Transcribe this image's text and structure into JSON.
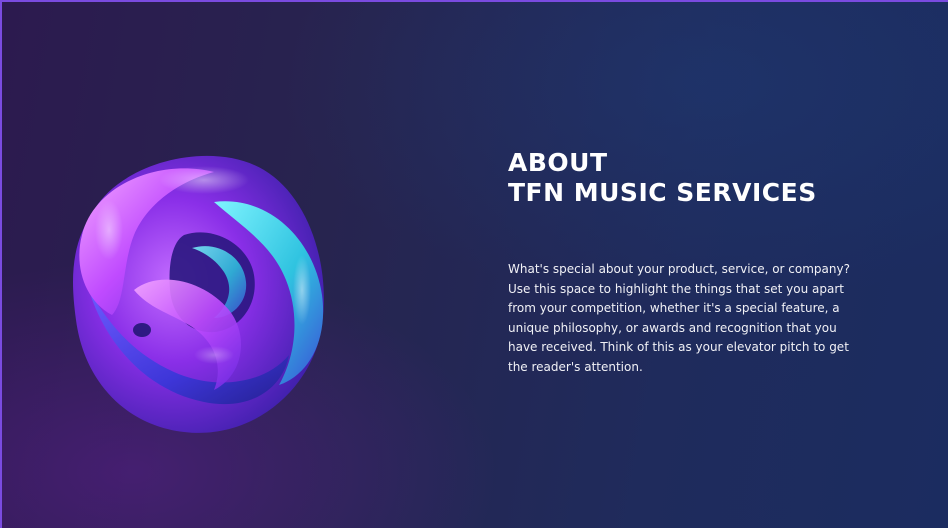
{
  "about": {
    "title_line1": "ABOUT",
    "title_line2": "TFN MUSIC SERVICES",
    "body": "What's special about your product, service, or company? Use this space to highlight the things that set you apart from your competition, whether it's a special feature, a unique philosophy, or awards and recognition that you have received. Think of this as your elevator pitch to get the reader's attention."
  },
  "hero_image": {
    "icon": "abstract-3d-chrome-sculpture",
    "colors": [
      "#a93cff",
      "#5b34e6",
      "#2fd7e4",
      "#e07bff"
    ]
  },
  "theme": {
    "background_left": "#2c1a4f",
    "background_right": "#1b2c60",
    "border_accent": "#7a4be0",
    "text": "#ffffff"
  }
}
